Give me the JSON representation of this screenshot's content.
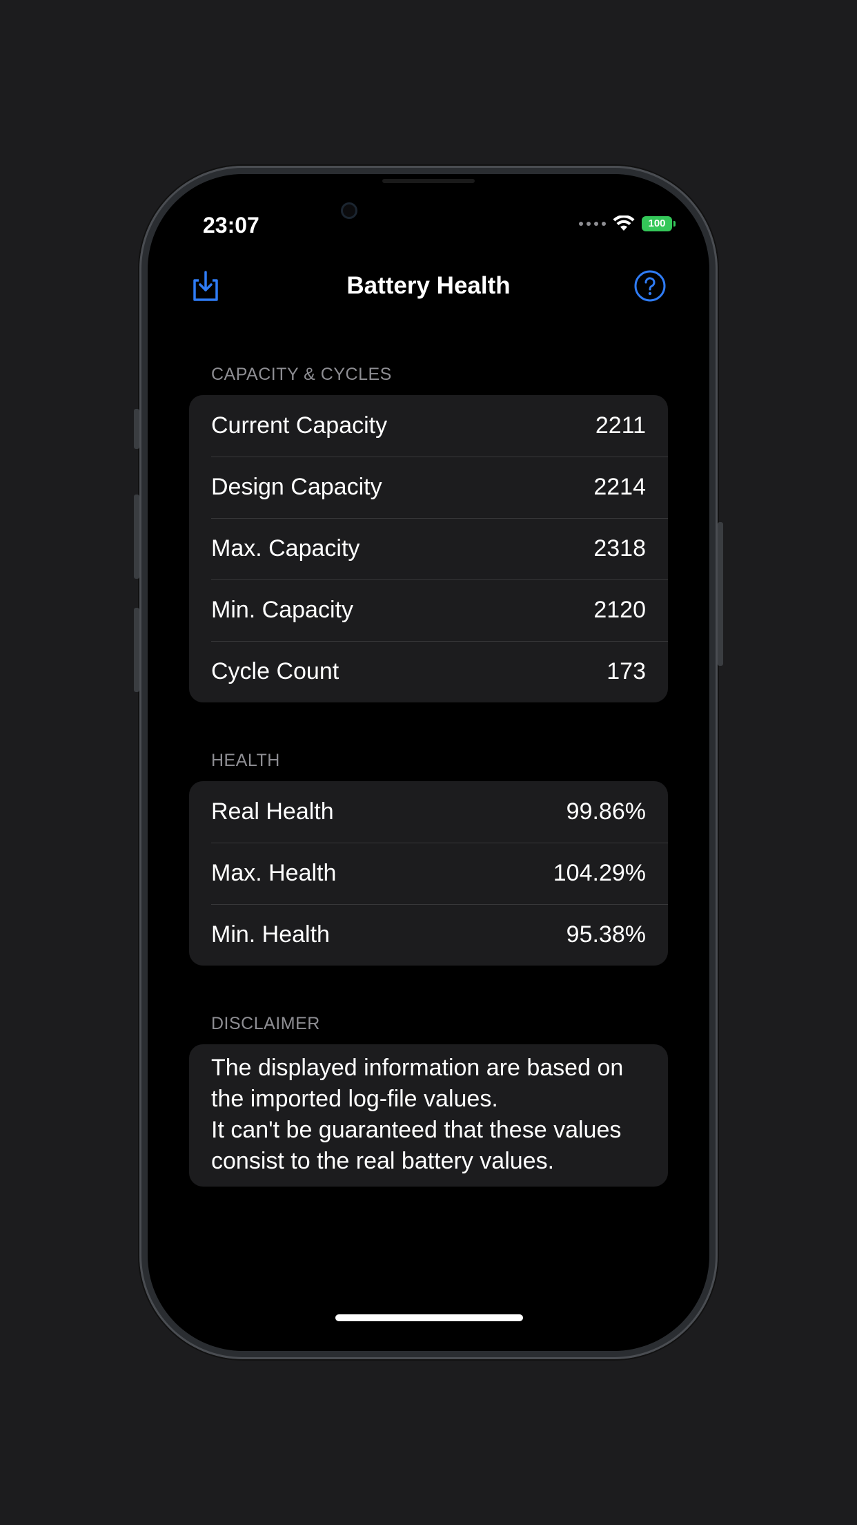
{
  "status_bar": {
    "time": "23:07",
    "battery_text": "100"
  },
  "nav": {
    "title": "Battery Health",
    "export_icon": "square-arrow-down-icon",
    "help_icon": "question-circle-icon"
  },
  "sections": {
    "capacity": {
      "header": "CAPACITY & CYCLES",
      "rows": [
        {
          "label": "Current Capacity",
          "value": "2211"
        },
        {
          "label": "Design Capacity",
          "value": "2214"
        },
        {
          "label": "Max. Capacity",
          "value": "2318"
        },
        {
          "label": "Min. Capacity",
          "value": "2120"
        },
        {
          "label": "Cycle Count",
          "value": "173"
        }
      ]
    },
    "health": {
      "header": "HEALTH",
      "rows": [
        {
          "label": "Real Health",
          "value": "99.86%"
        },
        {
          "label": "Max. Health",
          "value": "104.29%"
        },
        {
          "label": "Min. Health",
          "value": "95.38%"
        }
      ]
    },
    "disclaimer": {
      "header": "DISCLAIMER",
      "line1": "The displayed information are based on the imported log-file values.",
      "line2": "It can't be guaranteed that these values consist to the real battery values."
    }
  },
  "colors": {
    "accent": "#2f7cf6",
    "background": "#000000",
    "card": "#1c1c1e",
    "battery_green": "#34c759"
  }
}
